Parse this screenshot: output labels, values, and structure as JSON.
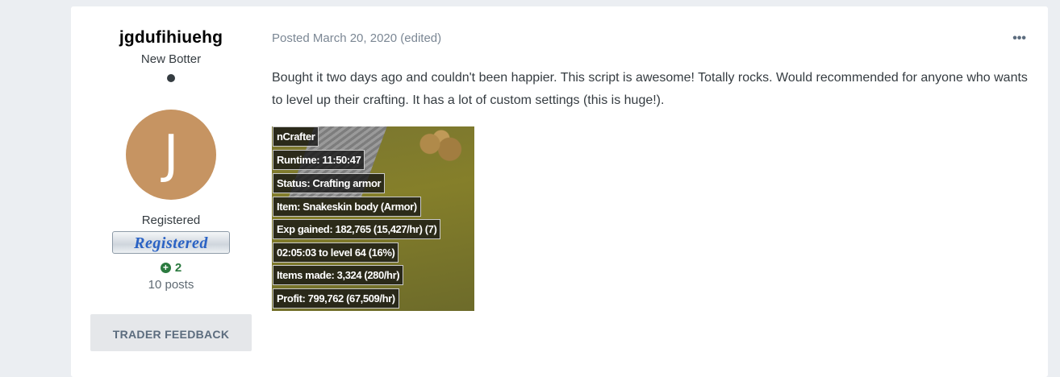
{
  "author": {
    "name": "jgdufihiuehg",
    "rank_title": "New Botter",
    "avatar_letter": "J",
    "avatar_color": "#c69462",
    "group_name": "Registered",
    "group_badge_text": "Registered",
    "reputation": "2",
    "posts": "10 posts",
    "trader_feedback_label": "TRADER FEEDBACK"
  },
  "post": {
    "meta": "Posted March 20, 2020 (edited)",
    "more_icon": "ellipsis-icon",
    "body": "Bought it two days ago and couldn't been happier. This script is awesome! Totally rocks. Would recommended for anyone who wants to level up their crafting. It has a lot of custom settings (this is huge!).",
    "screenshot_lines": [
      "nCrafter",
      "Runtime: 11:50:47",
      "Status: Crafting armor",
      "Item: Snakeskin body (Armor)",
      "Exp gained: 182,765 (15,427/hr) (7)",
      "02:05:03 to level 64 (16%)",
      "Items made: 3,324 (280/hr)",
      "Profit: 799,762 (67,509/hr)"
    ]
  }
}
